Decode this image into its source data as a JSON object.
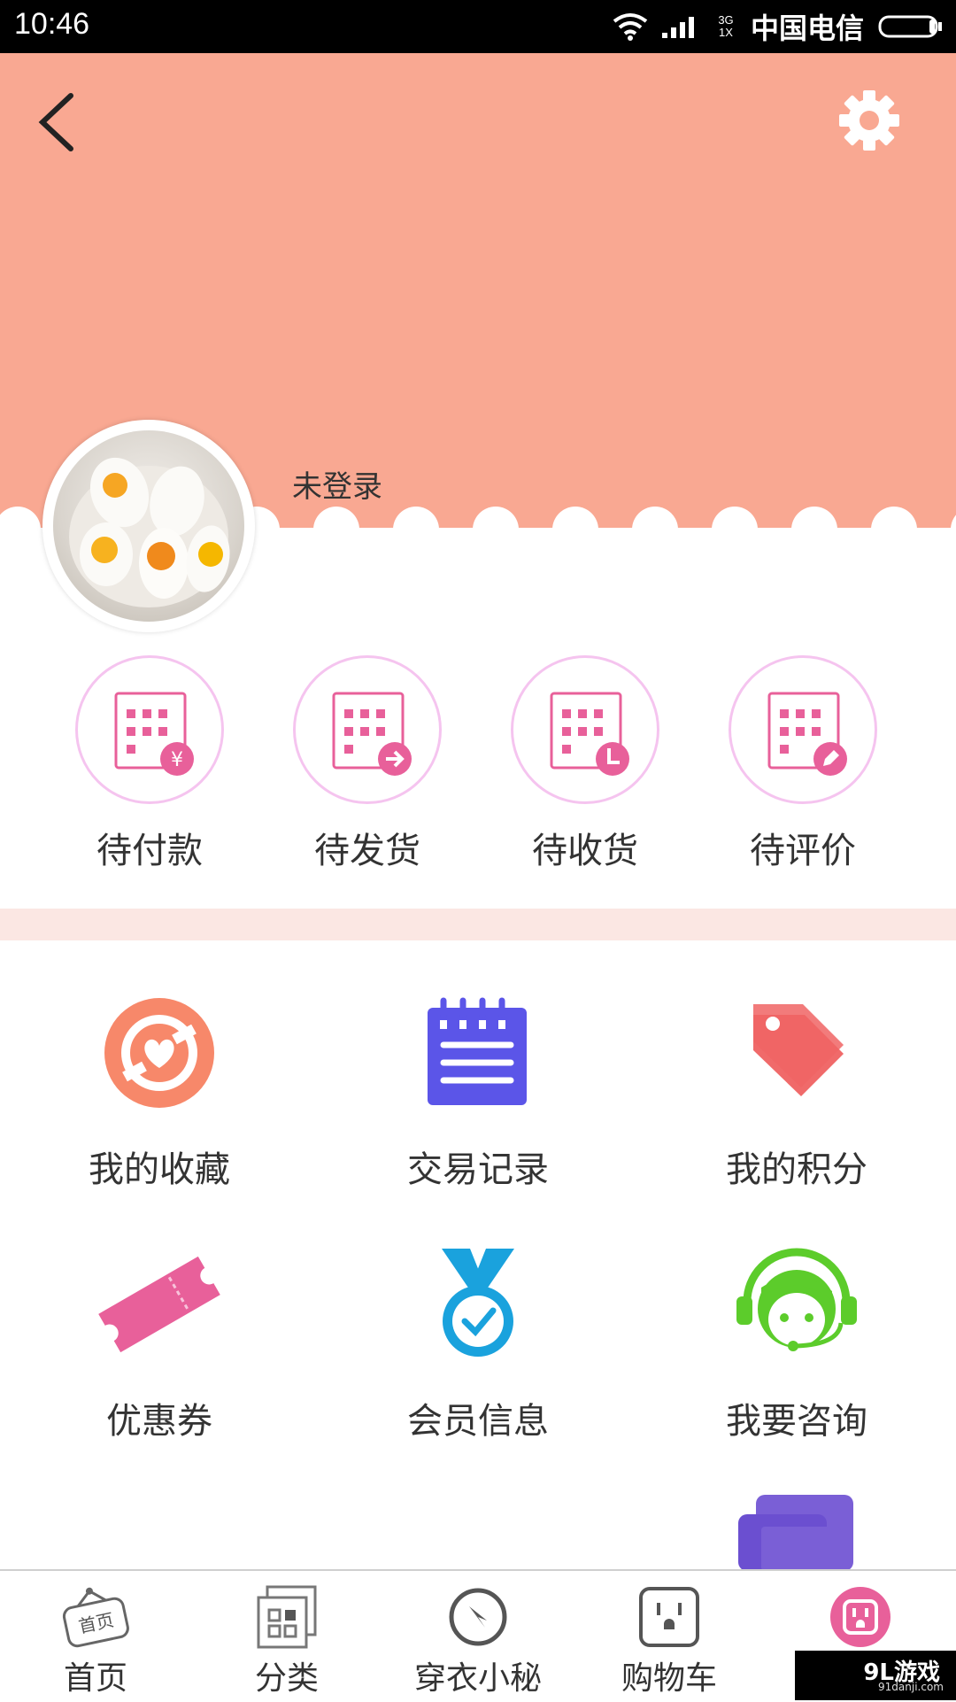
{
  "status_bar": {
    "time": "10:46",
    "network": "3G 1X",
    "carrier": "中国电信"
  },
  "header": {
    "login_status": "未登录"
  },
  "orders": [
    {
      "label": "待付款",
      "icon": "pending-payment-icon"
    },
    {
      "label": "待发货",
      "icon": "pending-shipment-icon"
    },
    {
      "label": "待收货",
      "icon": "pending-receipt-icon"
    },
    {
      "label": "待评价",
      "icon": "pending-review-icon"
    }
  ],
  "menu": [
    {
      "label": "我的收藏",
      "icon": "heart-icon"
    },
    {
      "label": "交易记录",
      "icon": "notepad-icon"
    },
    {
      "label": "我的积分",
      "icon": "tag-icon"
    },
    {
      "label": "优惠券",
      "icon": "ticket-icon"
    },
    {
      "label": "会员信息",
      "icon": "medal-icon"
    },
    {
      "label": "我要咨询",
      "icon": "headset-icon"
    }
  ],
  "bottom_nav": [
    {
      "label": "首页",
      "icon_text": "首页"
    },
    {
      "label": "分类"
    },
    {
      "label": "穿衣小秘"
    },
    {
      "label": "购物车"
    },
    {
      "label": ""
    }
  ],
  "watermark": {
    "brand": "9L游戏",
    "url": "91danji.com"
  },
  "colors": {
    "header": "#f9a892",
    "accent_pink": "#e8609a",
    "band": "#fbe7e3"
  }
}
